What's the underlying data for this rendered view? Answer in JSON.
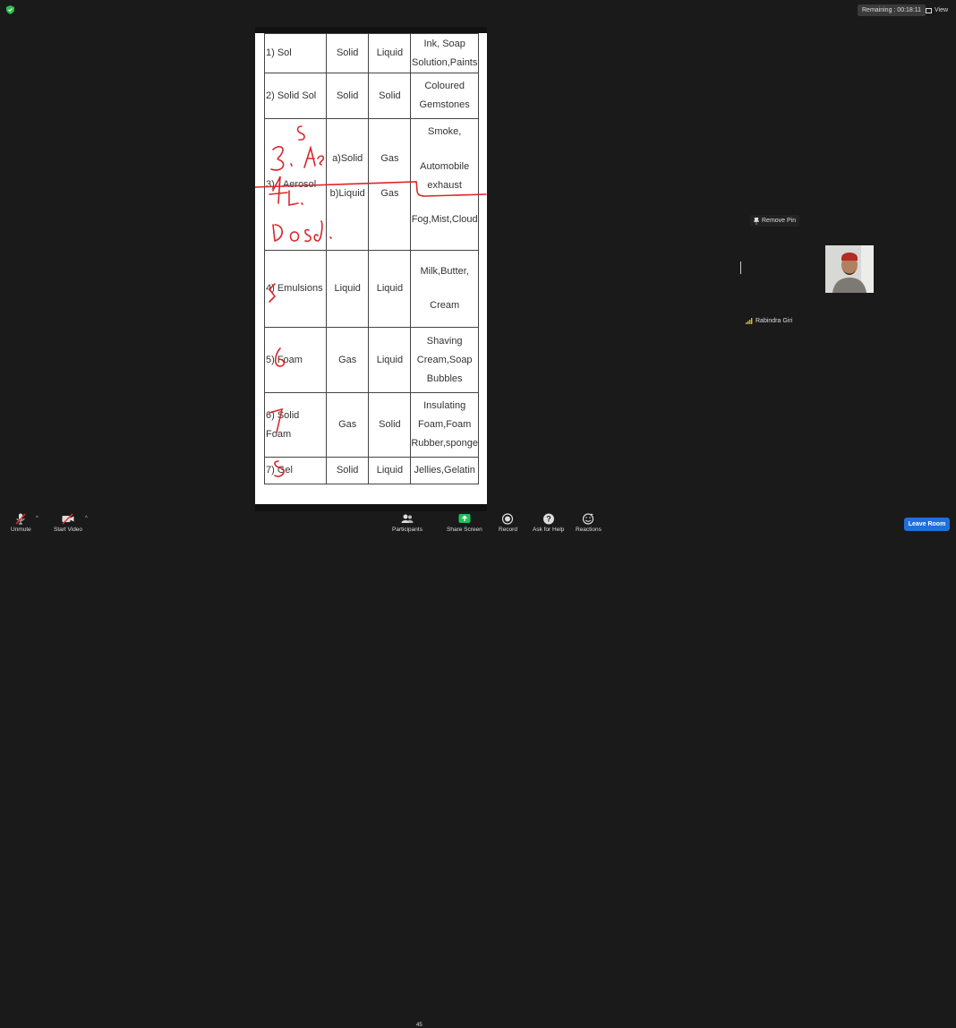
{
  "meeting": {
    "remaining": "Remaining : 00:18:11",
    "view_label": "View"
  },
  "document": {
    "rows": [
      {
        "name": "1)   Sol",
        "dispersed_phase": "Solid",
        "dispersion_medium": "Liquid",
        "examples": [
          "Ink, Soap",
          "Solution,Paints"
        ]
      },
      {
        "name": "2)   Solid Sol",
        "dispersed_phase": "Solid",
        "dispersion_medium": "Solid",
        "examples": [
          "Coloured",
          "Gemstones"
        ]
      },
      {
        "name": "3)  ·  Aerosol",
        "dispersed_phase": [
          "a)Solid",
          "b)Liquid"
        ],
        "dispersion_medium": [
          "Gas",
          "Gas"
        ],
        "examples": [
          "Smoke,",
          "Automobile",
          "exhaust",
          "Fog,Mist,Cloud"
        ]
      },
      {
        "name": "4)   Emulsions",
        "dispersed_phase": "Liquid",
        "dispersion_medium": "Liquid",
        "examples": [
          "Milk,Butter,",
          "Cream"
        ]
      },
      {
        "name": "5)   Foam",
        "dispersed_phase": "Gas",
        "dispersion_medium": "Liquid",
        "examples": [
          "Shaving",
          "Cream,Soap",
          "Bubbles"
        ]
      },
      {
        "name": [
          "6)   Solid",
          "Foam"
        ],
        "dispersed_phase": "Gas",
        "dispersion_medium": "Solid",
        "examples": [
          "Insulating",
          "Foam,Foam",
          "Rubber,sponge"
        ]
      },
      {
        "name": "7)   Gel",
        "dispersed_phase": "Solid",
        "dispersion_medium": "Liquid",
        "examples": [
          "Jellies,Gelatin"
        ]
      }
    ],
    "handwriting": [
      "3. S Aero",
      "4L. Dosol."
    ]
  },
  "pinned": {
    "remove_pin_label": "Remove Pin",
    "participant_name": "Rabindra Giri"
  },
  "toolbar": {
    "unmute": "Unmute",
    "start_video": "Start Video",
    "participants": "Participants",
    "participants_count": "45",
    "share_screen": "Share Screen",
    "record": "Record",
    "ask_for_help": "Ask for Help",
    "reactions": "Reactions",
    "leave_room": "Leave Room"
  },
  "colors": {
    "background": "#1a1a1a",
    "share_green": "#19c25a",
    "leave_blue": "#1f6fdd",
    "mic_red": "#e0322d",
    "ink_red": "#d9262a"
  }
}
